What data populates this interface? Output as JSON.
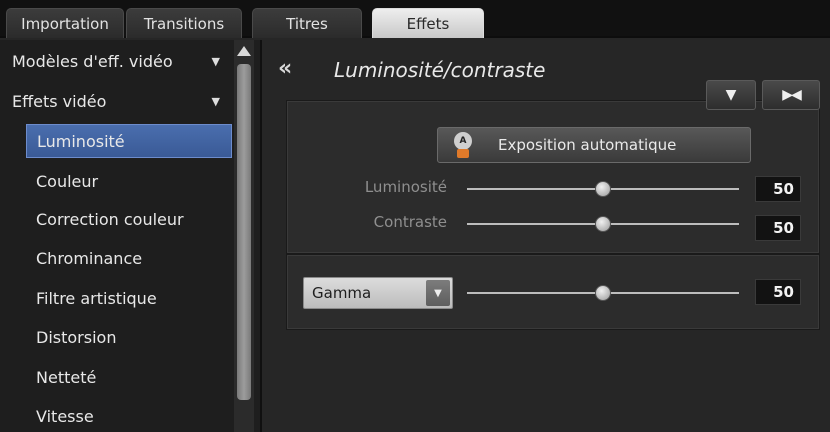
{
  "tabs": [
    {
      "label": "Importation",
      "active": false
    },
    {
      "label": "Transitions",
      "active": false
    },
    {
      "label": "Titres",
      "active": false
    },
    {
      "label": "Effets",
      "active": true
    }
  ],
  "sidebar": {
    "categories": [
      {
        "label": "Modèles d'eff. vidéo",
        "expanded": false
      },
      {
        "label": "Effets vidéo",
        "expanded": true
      }
    ],
    "items": [
      {
        "label": "Luminosité",
        "selected": true
      },
      {
        "label": "Couleur"
      },
      {
        "label": "Correction couleur"
      },
      {
        "label": "Chrominance"
      },
      {
        "label": "Filtre artistique"
      },
      {
        "label": "Distorsion"
      },
      {
        "label": "Netteté"
      },
      {
        "label": "Vitesse"
      }
    ]
  },
  "panel": {
    "title": "Luminosité/contraste",
    "auto_button": "Exposition automatique",
    "sliders": [
      {
        "label": "Luminosité",
        "value": "50",
        "level": 0.5
      },
      {
        "label": "Contraste",
        "value": "50",
        "level": 0.5
      }
    ],
    "gamma": {
      "select_value": "Gamma",
      "value": "50",
      "level": 0.5
    }
  },
  "icons": {
    "back": "double-chevron-left-icon",
    "auto": "auto-exposure-icon",
    "dropdown": "triangle-down-icon",
    "fit": "collapse-arrows-icon"
  },
  "colors": {
    "selection": "#4465a6",
    "accent_orange": "#e07a2a"
  }
}
